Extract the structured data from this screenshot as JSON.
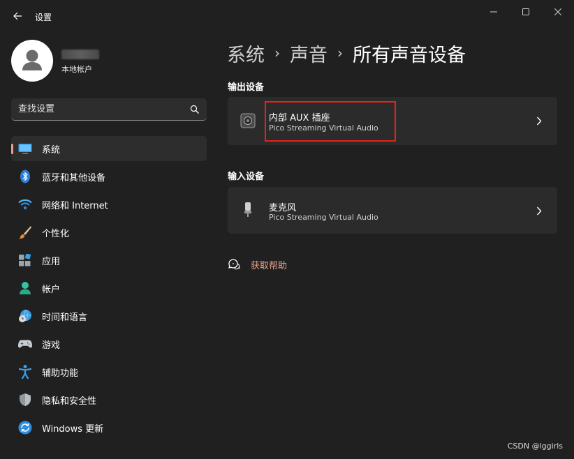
{
  "window": {
    "title": "设置"
  },
  "user": {
    "account_type": "本地帐户"
  },
  "search": {
    "placeholder": "查找设置"
  },
  "nav": {
    "items": [
      {
        "label": "系统",
        "icon": "display-icon",
        "active": true
      },
      {
        "label": "蓝牙和其他设备",
        "icon": "bluetooth-icon"
      },
      {
        "label": "网络和 Internet",
        "icon": "wifi-icon"
      },
      {
        "label": "个性化",
        "icon": "brush-icon"
      },
      {
        "label": "应用",
        "icon": "apps-icon"
      },
      {
        "label": "帐户",
        "icon": "person-icon"
      },
      {
        "label": "时间和语言",
        "icon": "globe-clock-icon"
      },
      {
        "label": "游戏",
        "icon": "gamepad-icon"
      },
      {
        "label": "辅助功能",
        "icon": "accessibility-icon"
      },
      {
        "label": "隐私和安全性",
        "icon": "shield-icon"
      },
      {
        "label": "Windows 更新",
        "icon": "update-icon"
      }
    ]
  },
  "breadcrumb": {
    "level1": "系统",
    "level2": "声音",
    "current": "所有声音设备"
  },
  "output": {
    "section_title": "输出设备",
    "device_name": "内部 AUX 插座",
    "device_driver": "Pico Streaming Virtual Audio"
  },
  "input": {
    "section_title": "输入设备",
    "device_name": "麦克风",
    "device_driver": "Pico Streaming Virtual Audio"
  },
  "help": {
    "label": "获取帮助"
  },
  "watermark": "CSDN @lggirls",
  "colors": {
    "accent": "#e5a28b",
    "background": "#202020",
    "card": "#2b2b2b",
    "highlight": "#e2231a"
  }
}
